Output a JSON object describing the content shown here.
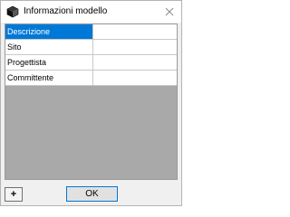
{
  "window": {
    "title": "Informazioni modello",
    "icon": "cube-icon",
    "close_icon": "close-icon"
  },
  "properties": [
    {
      "key": "Descrizione",
      "value": "",
      "selected": true
    },
    {
      "key": "Sito",
      "value": "",
      "selected": false
    },
    {
      "key": "Progettista",
      "value": "",
      "selected": false
    },
    {
      "key": "Committente",
      "value": "",
      "selected": false
    }
  ],
  "footer": {
    "add_label": "+",
    "ok_label": "OK"
  },
  "colors": {
    "selection": "#0078d7",
    "grid_background": "#a9a9a9",
    "dialog_background": "#f0f0f0"
  }
}
